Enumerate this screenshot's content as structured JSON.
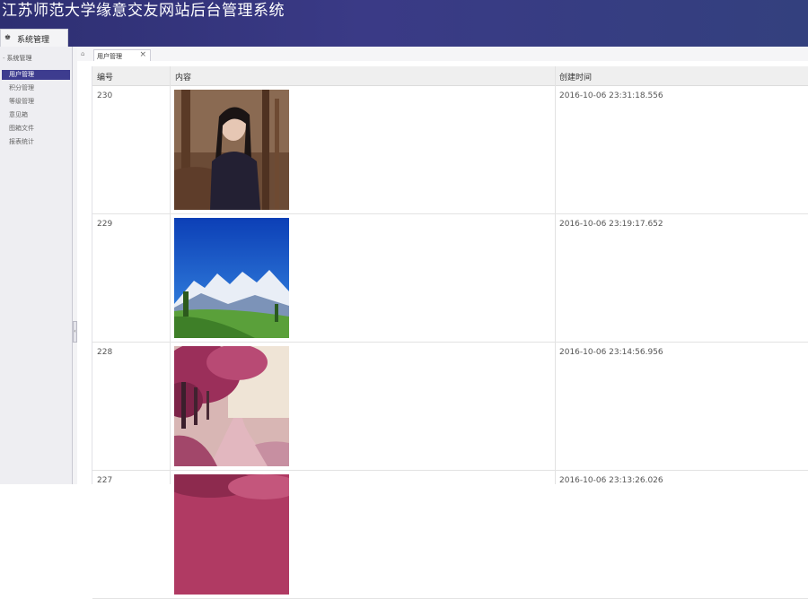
{
  "header": {
    "title": "江苏师范大学缘意交友网站后台管理系统"
  },
  "top_tab": {
    "icon": "home-icon",
    "label": "系统管理"
  },
  "sidebar": {
    "group_label": "系统管理",
    "items": [
      {
        "label": "用户管理",
        "active": true
      },
      {
        "label": "积分管理",
        "active": false
      },
      {
        "label": "等级管理",
        "active": false
      },
      {
        "label": "意见箱",
        "active": false
      },
      {
        "label": "图箱文件",
        "active": false
      },
      {
        "label": "报表统计",
        "active": false
      }
    ]
  },
  "tabs": {
    "active_label": "用户管理",
    "close_glyph": "×"
  },
  "grid": {
    "columns": [
      "编号",
      "内容",
      "创建时间"
    ],
    "rows": [
      {
        "id": "230",
        "image": "portrait-photo",
        "created": "2016-10-06 23:31:18.556"
      },
      {
        "id": "229",
        "image": "mountain-landscape-photo",
        "created": "2016-10-06 23:19:17.652"
      },
      {
        "id": "228",
        "image": "pink-tree-path-photo",
        "created": "2016-10-06 23:14:56.956"
      },
      {
        "id": "227",
        "image": "pink-photo",
        "created": "2016-10-06 23:13:26.026"
      }
    ]
  },
  "colors": {
    "header": "#33387e",
    "sidebar_active": "#3d3c8f"
  }
}
